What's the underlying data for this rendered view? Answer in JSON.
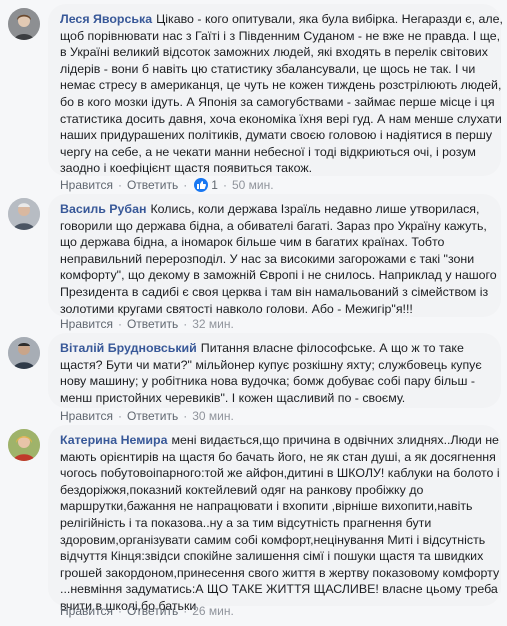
{
  "comments": [
    {
      "author": "Леся Яворська",
      "lines": [
        "Цікаво - кого опитували, яка була вибірка. Негаразди є, але,",
        "щоб порівнювати нас з Гаїті і з Південним Суданом - не вже не правда. І ще,",
        "в Україні великий відсоток заможних людей, які входять в перелік світових",
        "лідерів - вони б навіть цю статистику збалансували, це щось не так. І чи",
        "немає стресу в американця, це чуть не кожен тиждень розстрілюють людей,",
        "бо в кого мозки ідуть. А Японія за самогубствами - займає перше місце і ця",
        "статистика досить давня, хоча економіка їхня вері гуд. А нам менше слухати",
        "наших придурашених політиків, думати своєю головою і надіятися в першу",
        "чергу на себе, а не чекати манни небесної і тоді відкриються очі, і розум",
        "заодно і коефіцієнт щастя появиться також."
      ],
      "actions": {
        "like": "Нравится",
        "reply": "Ответить",
        "reactions": "1",
        "time": "50 мин."
      }
    },
    {
      "author": "Василь Рубан",
      "lines": [
        "Колись, коли держава Ізраїль недавно лише утворилася,",
        "говорили що держава бідна, а обивателі багаті. Зараз про Україну кажуть,",
        "що держава бідна, а іномарок більше чим в багатих країнах. Тобто",
        "неправильний перерозподіл. У нас за високими загорожами є такі \"зони",
        "комфорту\", що декому в заможній Європі і не снилось. Наприклад у нашого",
        "Президента в садибі є своя церква і там він намальований з сімейством із",
        "золотими кругами святості навколо голови. Або - Межигір\"я!!!"
      ],
      "actions": {
        "like": "Нравится",
        "reply": "Ответить",
        "time": "32 мин."
      }
    },
    {
      "author": "Віталій Брудновський",
      "lines": [
        "Питання власне філософське. А що ж то таке",
        "щастя? Бути чи мати?\" мільйонер купує розкішну яхту; службовець купує",
        "нову машину; у робітника нова вудочка; бомж добуває собі пару більш -",
        "менш пристойних черевиків\". І кожен щасливий по - своєму."
      ],
      "actions": {
        "like": "Нравится",
        "reply": "Ответить",
        "time": "30 мин."
      }
    },
    {
      "author": "Катерина Немира",
      "lines": [
        "мені видається,що причина в одвічних злиднях..Люди не",
        "мають орієнтирів на щастя бо бачать його, не як стан душі, а як досягнення",
        "чогось побутовоіпарного:той же айфон,дитині в ШКОЛУ! каблуки на болото і",
        "бездоріжжя,показний коктейлевий одяг на ранкову пробіжку до",
        "маршрутки,бажання не напрацювати і вхопити ,вірніше вихопити,навіть",
        "релігійність і та показова..ну а за тим відсутність прагнення бути",
        "здоровим,організувати самим собі комфорт,нецінування Миті і відсутність",
        "відчуття Кінця:звідси спокійне залишення сімї і пошуки щастя та швидких",
        "грошей закордоном,принесення свого життя в жертву показовому комфорту",
        "...невміння задуматись:А ЩО ТАКЕ ЖИТТЯ ЩАСЛИВЕ! власне цьому треба",
        "вчити в школі,бо батьки"
      ],
      "actions": {
        "like": "Нравится",
        "reply": "Ответить",
        "time": "26 мин."
      }
    }
  ],
  "colors": {
    "author": "#385898",
    "like_badge": "#1877f2",
    "bubble": "#f2f3f5"
  }
}
